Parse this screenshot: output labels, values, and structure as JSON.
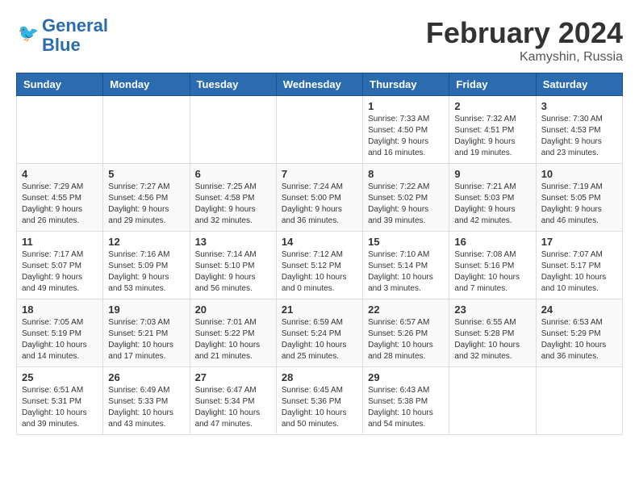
{
  "header": {
    "logo_line1": "General",
    "logo_line2": "Blue",
    "main_title": "February 2024",
    "subtitle": "Kamyshin, Russia"
  },
  "weekdays": [
    "Sunday",
    "Monday",
    "Tuesday",
    "Wednesday",
    "Thursday",
    "Friday",
    "Saturday"
  ],
  "weeks": [
    [
      {
        "day": "",
        "info": ""
      },
      {
        "day": "",
        "info": ""
      },
      {
        "day": "",
        "info": ""
      },
      {
        "day": "",
        "info": ""
      },
      {
        "day": "1",
        "info": "Sunrise: 7:33 AM\nSunset: 4:50 PM\nDaylight: 9 hours\nand 16 minutes."
      },
      {
        "day": "2",
        "info": "Sunrise: 7:32 AM\nSunset: 4:51 PM\nDaylight: 9 hours\nand 19 minutes."
      },
      {
        "day": "3",
        "info": "Sunrise: 7:30 AM\nSunset: 4:53 PM\nDaylight: 9 hours\nand 23 minutes."
      }
    ],
    [
      {
        "day": "4",
        "info": "Sunrise: 7:29 AM\nSunset: 4:55 PM\nDaylight: 9 hours\nand 26 minutes."
      },
      {
        "day": "5",
        "info": "Sunrise: 7:27 AM\nSunset: 4:56 PM\nDaylight: 9 hours\nand 29 minutes."
      },
      {
        "day": "6",
        "info": "Sunrise: 7:25 AM\nSunset: 4:58 PM\nDaylight: 9 hours\nand 32 minutes."
      },
      {
        "day": "7",
        "info": "Sunrise: 7:24 AM\nSunset: 5:00 PM\nDaylight: 9 hours\nand 36 minutes."
      },
      {
        "day": "8",
        "info": "Sunrise: 7:22 AM\nSunset: 5:02 PM\nDaylight: 9 hours\nand 39 minutes."
      },
      {
        "day": "9",
        "info": "Sunrise: 7:21 AM\nSunset: 5:03 PM\nDaylight: 9 hours\nand 42 minutes."
      },
      {
        "day": "10",
        "info": "Sunrise: 7:19 AM\nSunset: 5:05 PM\nDaylight: 9 hours\nand 46 minutes."
      }
    ],
    [
      {
        "day": "11",
        "info": "Sunrise: 7:17 AM\nSunset: 5:07 PM\nDaylight: 9 hours\nand 49 minutes."
      },
      {
        "day": "12",
        "info": "Sunrise: 7:16 AM\nSunset: 5:09 PM\nDaylight: 9 hours\nand 53 minutes."
      },
      {
        "day": "13",
        "info": "Sunrise: 7:14 AM\nSunset: 5:10 PM\nDaylight: 9 hours\nand 56 minutes."
      },
      {
        "day": "14",
        "info": "Sunrise: 7:12 AM\nSunset: 5:12 PM\nDaylight: 10 hours\nand 0 minutes."
      },
      {
        "day": "15",
        "info": "Sunrise: 7:10 AM\nSunset: 5:14 PM\nDaylight: 10 hours\nand 3 minutes."
      },
      {
        "day": "16",
        "info": "Sunrise: 7:08 AM\nSunset: 5:16 PM\nDaylight: 10 hours\nand 7 minutes."
      },
      {
        "day": "17",
        "info": "Sunrise: 7:07 AM\nSunset: 5:17 PM\nDaylight: 10 hours\nand 10 minutes."
      }
    ],
    [
      {
        "day": "18",
        "info": "Sunrise: 7:05 AM\nSunset: 5:19 PM\nDaylight: 10 hours\nand 14 minutes."
      },
      {
        "day": "19",
        "info": "Sunrise: 7:03 AM\nSunset: 5:21 PM\nDaylight: 10 hours\nand 17 minutes."
      },
      {
        "day": "20",
        "info": "Sunrise: 7:01 AM\nSunset: 5:22 PM\nDaylight: 10 hours\nand 21 minutes."
      },
      {
        "day": "21",
        "info": "Sunrise: 6:59 AM\nSunset: 5:24 PM\nDaylight: 10 hours\nand 25 minutes."
      },
      {
        "day": "22",
        "info": "Sunrise: 6:57 AM\nSunset: 5:26 PM\nDaylight: 10 hours\nand 28 minutes."
      },
      {
        "day": "23",
        "info": "Sunrise: 6:55 AM\nSunset: 5:28 PM\nDaylight: 10 hours\nand 32 minutes."
      },
      {
        "day": "24",
        "info": "Sunrise: 6:53 AM\nSunset: 5:29 PM\nDaylight: 10 hours\nand 36 minutes."
      }
    ],
    [
      {
        "day": "25",
        "info": "Sunrise: 6:51 AM\nSunset: 5:31 PM\nDaylight: 10 hours\nand 39 minutes."
      },
      {
        "day": "26",
        "info": "Sunrise: 6:49 AM\nSunset: 5:33 PM\nDaylight: 10 hours\nand 43 minutes."
      },
      {
        "day": "27",
        "info": "Sunrise: 6:47 AM\nSunset: 5:34 PM\nDaylight: 10 hours\nand 47 minutes."
      },
      {
        "day": "28",
        "info": "Sunrise: 6:45 AM\nSunset: 5:36 PM\nDaylight: 10 hours\nand 50 minutes."
      },
      {
        "day": "29",
        "info": "Sunrise: 6:43 AM\nSunset: 5:38 PM\nDaylight: 10 hours\nand 54 minutes."
      },
      {
        "day": "",
        "info": ""
      },
      {
        "day": "",
        "info": ""
      }
    ]
  ]
}
